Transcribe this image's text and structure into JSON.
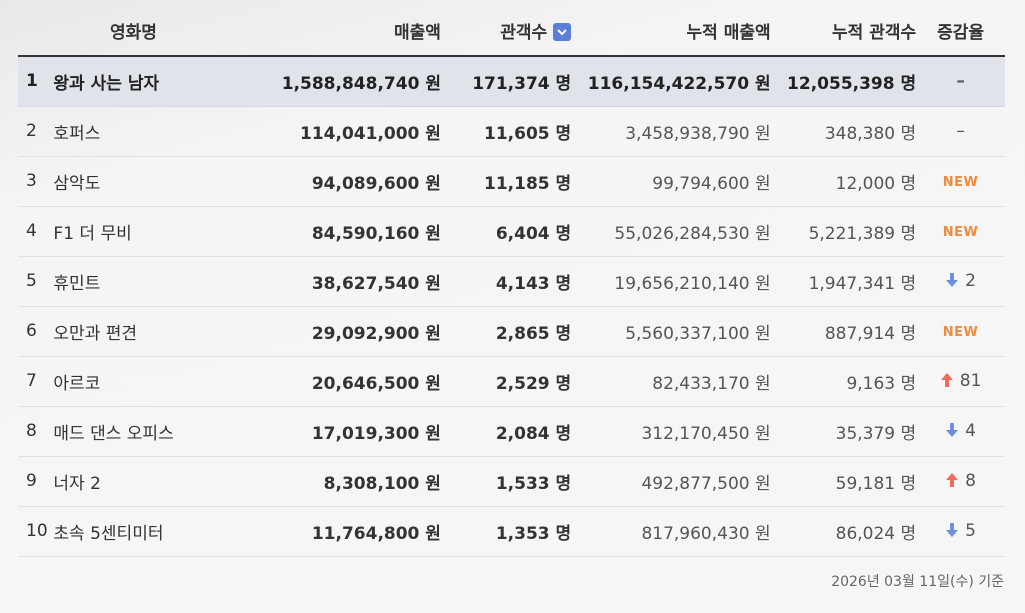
{
  "headers": {
    "title": "영화명",
    "sales": "매출액",
    "audience": "관객수",
    "cum_sales": "누적 매출액",
    "cum_audience": "누적 관객수",
    "change": "증감율"
  },
  "rows": [
    {
      "rank": "1",
      "title": "왕과 사는 남자",
      "sales": "1,588,848,740 원",
      "audience": "171,374 명",
      "cum_sales": "116,154,422,570 원",
      "cum_audience": "12,055,398 명",
      "change_type": "same",
      "change_text": "–"
    },
    {
      "rank": "2",
      "title": "호퍼스",
      "sales": "114,041,000 원",
      "audience": "11,605 명",
      "cum_sales": "3,458,938,790 원",
      "cum_audience": "348,380 명",
      "change_type": "same",
      "change_text": "–"
    },
    {
      "rank": "3",
      "title": "삼악도",
      "sales": "94,089,600 원",
      "audience": "11,185 명",
      "cum_sales": "99,794,600 원",
      "cum_audience": "12,000 명",
      "change_type": "new",
      "change_text": "NEW"
    },
    {
      "rank": "4",
      "title": "F1 더 무비",
      "sales": "84,590,160 원",
      "audience": "6,404 명",
      "cum_sales": "55,026,284,530 원",
      "cum_audience": "5,221,389 명",
      "change_type": "new",
      "change_text": "NEW"
    },
    {
      "rank": "5",
      "title": "휴민트",
      "sales": "38,627,540 원",
      "audience": "4,143 명",
      "cum_sales": "19,656,210,140 원",
      "cum_audience": "1,947,341 명",
      "change_type": "down",
      "change_text": "2"
    },
    {
      "rank": "6",
      "title": "오만과 편견",
      "sales": "29,092,900 원",
      "audience": "2,865 명",
      "cum_sales": "5,560,337,100 원",
      "cum_audience": "887,914 명",
      "change_type": "new",
      "change_text": "NEW"
    },
    {
      "rank": "7",
      "title": "아르코",
      "sales": "20,646,500 원",
      "audience": "2,529 명",
      "cum_sales": "82,433,170 원",
      "cum_audience": "9,163 명",
      "change_type": "up",
      "change_text": "81"
    },
    {
      "rank": "8",
      "title": "매드 댄스 오피스",
      "sales": "17,019,300 원",
      "audience": "2,084 명",
      "cum_sales": "312,170,450 원",
      "cum_audience": "35,379 명",
      "change_type": "down",
      "change_text": "4"
    },
    {
      "rank": "9",
      "title": "너자 2",
      "sales": "8,308,100 원",
      "audience": "1,533 명",
      "cum_sales": "492,877,500 원",
      "cum_audience": "59,181 명",
      "change_type": "up",
      "change_text": "8"
    },
    {
      "rank": "10",
      "title": "초속 5센티미터",
      "sales": "11,764,800 원",
      "audience": "1,353 명",
      "cum_sales": "817,960,430 원",
      "cum_audience": "86,024 명",
      "change_type": "down",
      "change_text": "5"
    }
  ],
  "footer": {
    "date_note": "2026년 03월 11일(수) 기준"
  },
  "colors": {
    "up": "#f06b5b",
    "down": "#6c8fe0",
    "new": "#f08a3c",
    "sort_button": "#5b7fd9"
  },
  "icons": {
    "sort": "chevron-down-icon",
    "up": "arrow-up-icon",
    "down": "arrow-down-icon"
  }
}
